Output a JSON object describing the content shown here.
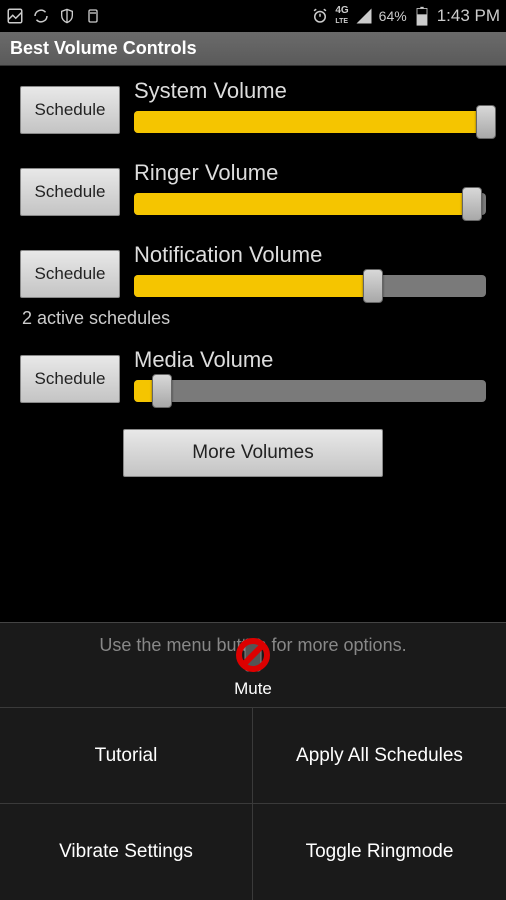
{
  "status": {
    "battery_pct": "64%",
    "time": "1:43 PM",
    "network": "4G LTE"
  },
  "app_title": "Best Volume Controls",
  "volumes": [
    {
      "label": "System Volume",
      "schedule_btn": "Schedule",
      "value": 100
    },
    {
      "label": "Ringer Volume",
      "schedule_btn": "Schedule",
      "value": 96
    },
    {
      "label": "Notification Volume",
      "schedule_btn": "Schedule",
      "value": 68
    },
    {
      "label": "Media Volume",
      "schedule_btn": "Schedule",
      "value": 8
    }
  ],
  "active_schedules_text": "2 active schedules",
  "more_volumes_label": "More Volumes",
  "menu_hint": "Use the menu button for more options.",
  "mute_label": "Mute",
  "menu_items": {
    "tutorial": "Tutorial",
    "apply_all": "Apply All Schedules",
    "vibrate": "Vibrate Settings",
    "toggle_ring": "Toggle Ringmode"
  }
}
